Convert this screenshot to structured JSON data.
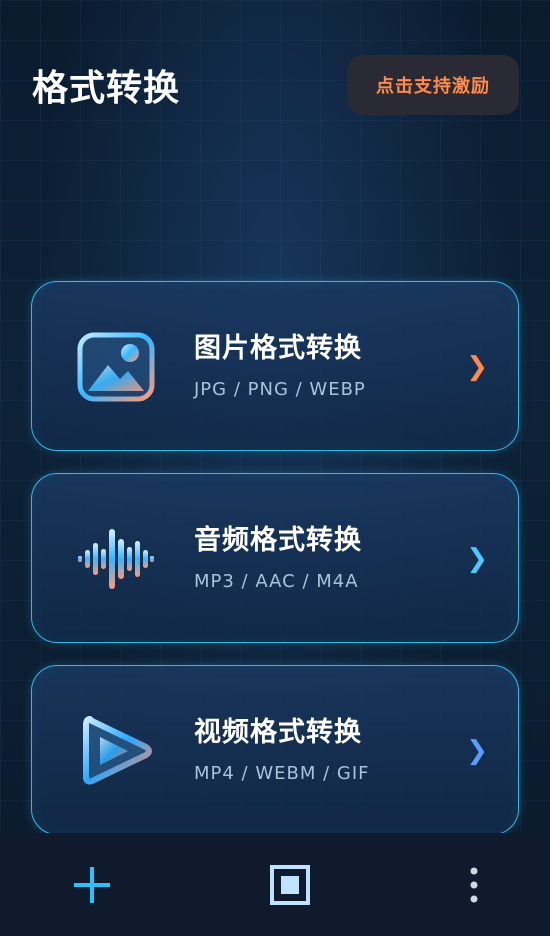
{
  "header": {
    "title": "格式转换",
    "support_label": "点击支持激励"
  },
  "cards": [
    {
      "name": "图片格式转换",
      "formats": "JPG / PNG / WEBP",
      "icon": "image-icon",
      "chevron": "❯",
      "chevron_color": "#ff8a4c"
    },
    {
      "name": "音频格式转换",
      "formats": "MP3 / AAC / M4A",
      "icon": "audio-wave-icon",
      "chevron": "❯",
      "chevron_color": "#4cc8ff"
    },
    {
      "name": "视频格式转换",
      "formats": "MP4 / WEBM / GIF",
      "icon": "play-icon",
      "chevron": "❯",
      "chevron_color": "#5a9bff"
    }
  ],
  "bottom_bar": {
    "items": [
      "add-icon",
      "square-icon",
      "more-vertical-icon"
    ]
  },
  "colors": {
    "accent": "#35b8e8",
    "support_text": "#ff8a4c",
    "background": "#0b1b2e"
  }
}
